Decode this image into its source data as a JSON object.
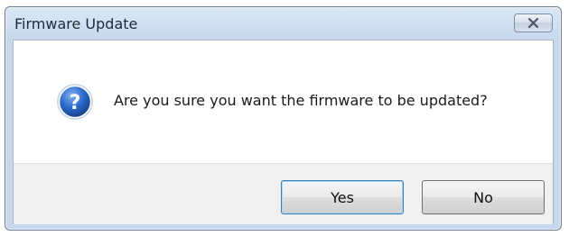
{
  "window": {
    "title": "Firmware Update"
  },
  "titlebar": {
    "close_icon": "close-icon"
  },
  "dialog": {
    "icon": "question-icon",
    "message": "Are you sure you want the firmware to be updated?"
  },
  "buttons": {
    "yes_label": "Yes",
    "no_label": "No"
  },
  "colors": {
    "titlebar": "#c7d8ee",
    "footer": "#f0f0f0",
    "question_icon": "#1f5fbf"
  }
}
